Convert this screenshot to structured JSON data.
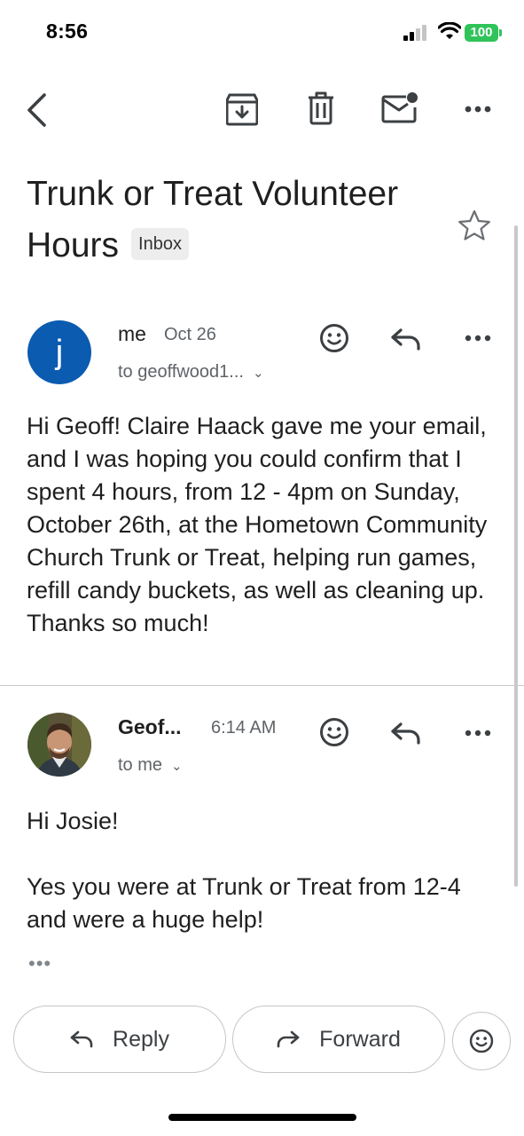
{
  "status_bar": {
    "time": "8:56",
    "battery": "100",
    "icons": [
      "signal-icon",
      "wifi-icon",
      "battery-icon"
    ]
  },
  "toolbar": {
    "icons": [
      "back-arrow-icon",
      "archive-icon",
      "trash-icon",
      "mark-unread-icon",
      "more-icon"
    ]
  },
  "subject": {
    "title": "Trunk or Treat Volunteer Hours",
    "label": "Inbox"
  },
  "messages": [
    {
      "avatar_letter": "j",
      "avatar_color": "#0b5bb0",
      "sender": "me",
      "date": "Oct 26",
      "recipient": "to geoffwood1...",
      "body": "Hi Geoff! Claire Haack gave me your email, and I was hoping you could confirm that I spent 4 hours, from 12 - 4pm on Sunday, October 26th, at the Hometown Community Church Trunk or Treat, helping run games, refill candy buckets, as well as cleaning up. Thanks so much!"
    },
    {
      "sender": "Geof...",
      "date": "6:14 AM",
      "recipient": "to me",
      "greeting": "Hi Josie!",
      "body": "Yes you were at Trunk or Treat from 12-4 and were a huge help!",
      "trimmed_indicator": "•••"
    }
  ],
  "actions": {
    "reply": "Reply",
    "forward": "Forward"
  }
}
